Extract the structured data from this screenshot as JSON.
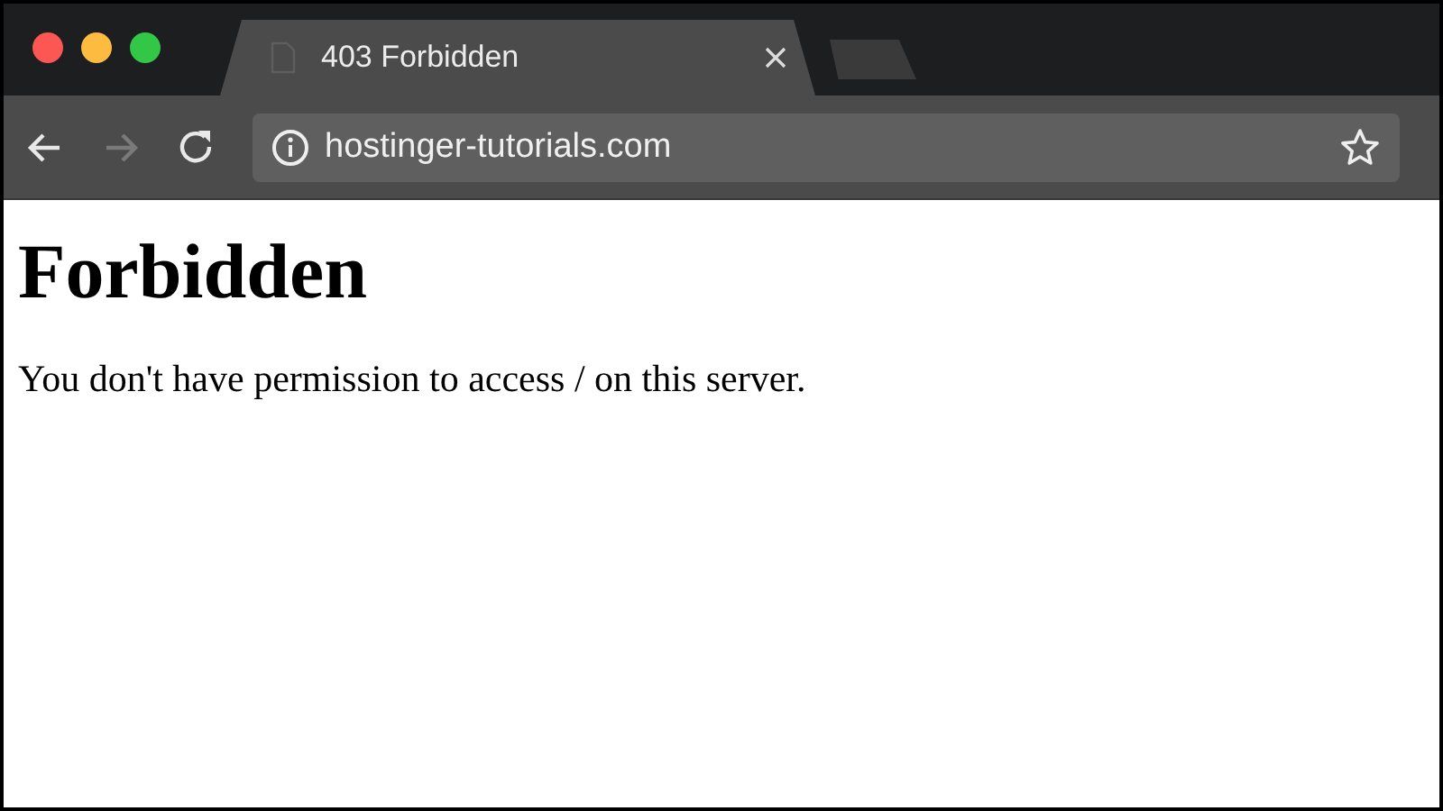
{
  "tabs": [
    {
      "kind": "page",
      "title": "403 Forbidden",
      "selected": true
    },
    {
      "kind": "new",
      "selected": false
    }
  ],
  "toolbar": {
    "back": {
      "disabled": false
    },
    "forward": {
      "disabled": true
    },
    "url": "hostinger-tutorials.com"
  },
  "page": {
    "heading": "Forbidden",
    "message": "You don't have permission to access / on this server."
  }
}
